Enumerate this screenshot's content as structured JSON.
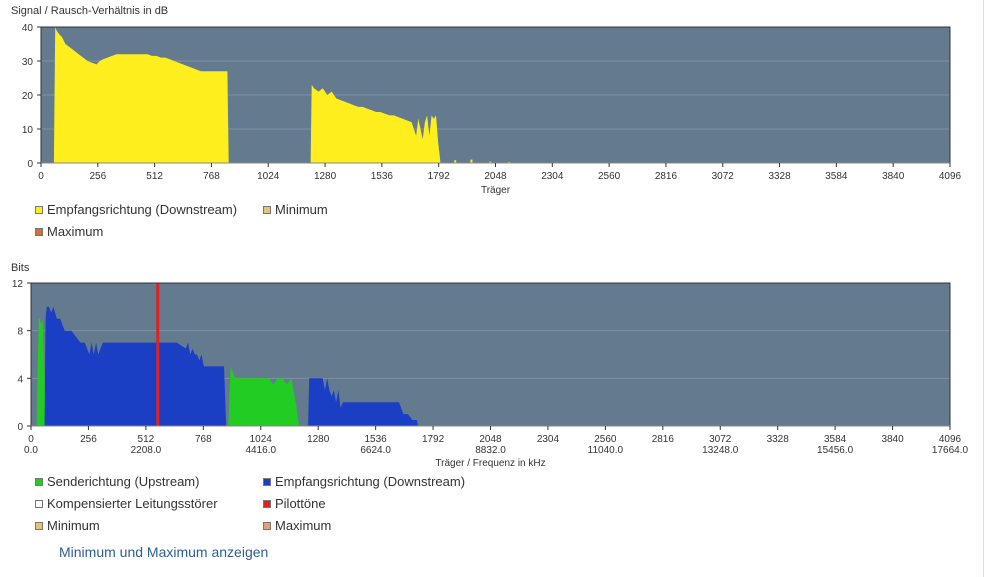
{
  "snr_chart": {
    "ylabel": "Signal / Rausch-Verhältnis in dB",
    "xlabel": "Träger",
    "legend": [
      {
        "label": "Empfangsrichtung (Downstream)",
        "color": "#ffee1e"
      },
      {
        "label": "Minimum",
        "color": "#e8c27a"
      },
      {
        "label": "Maximum",
        "color": "#c8733a"
      }
    ]
  },
  "bits_chart": {
    "ylabel": "Bits",
    "xlabel": "Träger / Frequenz in kHz",
    "legend": [
      {
        "label": "Senderichtung (Upstream)",
        "color": "#22cc22"
      },
      {
        "label": "Empfangsrichtung (Downstream)",
        "color": "#1a3fc4"
      },
      {
        "label": "Kompensierter Leitungsstörer",
        "color": "#ffffff"
      },
      {
        "label": "Pilottöne",
        "color": "#dd2222"
      },
      {
        "label": "Minimum",
        "color": "#e8c27a"
      },
      {
        "label": "Maximum",
        "color": "#e8a06a"
      }
    ]
  },
  "toggle_link": "Minimum und Maximum anzeigen",
  "colors": {
    "plot_bg": "#647a8e",
    "grid": "#7e92a4"
  },
  "chart_data": [
    {
      "type": "area",
      "title": "",
      "xlabel": "Träger",
      "ylabel": "Signal / Rausch-Verhältnis in dB",
      "xlim": [
        0,
        4096
      ],
      "ylim": [
        0,
        40
      ],
      "x_ticks": [
        0,
        256,
        512,
        768,
        1024,
        1280,
        1536,
        1792,
        2048,
        2304,
        2560,
        2816,
        3072,
        3328,
        3584,
        3840,
        4096
      ],
      "y_ticks": [
        0,
        10,
        20,
        30,
        40
      ],
      "grid": true,
      "legend_position": "bottom",
      "series": [
        {
          "name": "Empfangsrichtung (Downstream)",
          "color": "#ffee1e",
          "x": [
            58,
            64,
            70,
            80,
            95,
            110,
            130,
            150,
            170,
            190,
            210,
            230,
            250,
            265,
            280,
            300,
            320,
            340,
            360,
            380,
            400,
            420,
            440,
            460,
            480,
            500,
            520,
            540,
            560,
            580,
            600,
            620,
            640,
            660,
            680,
            700,
            720,
            740,
            760,
            780,
            800,
            820,
            840,
            846,
            1215,
            1220,
            1230,
            1250,
            1270,
            1290,
            1310,
            1330,
            1350,
            1370,
            1390,
            1410,
            1430,
            1450,
            1470,
            1490,
            1510,
            1530,
            1550,
            1570,
            1590,
            1610,
            1630,
            1650,
            1670,
            1690,
            1700,
            1710,
            1720,
            1730,
            1740,
            1750,
            1760,
            1770,
            1780,
            1790,
            1800
          ],
          "y": [
            0,
            40,
            39,
            38,
            37,
            35,
            34,
            33,
            32,
            31,
            30,
            29.5,
            29,
            30,
            30.5,
            31,
            31.5,
            32,
            32,
            32,
            32,
            32,
            32,
            32,
            32,
            31.5,
            31.5,
            31,
            31,
            30.5,
            30,
            29.5,
            29,
            28.5,
            28,
            27.5,
            27,
            27,
            27,
            27,
            27,
            27,
            27,
            0,
            0,
            23,
            22,
            21,
            22,
            20,
            21,
            19,
            18.5,
            18,
            17.5,
            17,
            16.5,
            16.5,
            16,
            15.5,
            15,
            15,
            14.5,
            14,
            14,
            13.5,
            13,
            12.5,
            12,
            8,
            13,
            10,
            7,
            12,
            14,
            8,
            14,
            13,
            14,
            6,
            0
          ]
        }
      ]
    },
    {
      "type": "area",
      "title": "",
      "xlabel": "Träger / Frequenz in kHz",
      "ylabel": "Bits",
      "xlim": [
        0,
        4096
      ],
      "ylim": [
        0,
        12
      ],
      "x_ticks": [
        0,
        256,
        512,
        768,
        1024,
        1280,
        1536,
        1792,
        2048,
        2304,
        2560,
        2816,
        3072,
        3328,
        3584,
        3840,
        4096
      ],
      "x_ticks_khz": [
        "0.0",
        "2208.0",
        "4416.0",
        "6624.0",
        "8832.0",
        "11040.0",
        "13248.0",
        "15456.0",
        "17664.0"
      ],
      "y_ticks": [
        0,
        4,
        8,
        12
      ],
      "grid": true,
      "legend_position": "bottom",
      "series": [
        {
          "name": "Senderichtung (Upstream)",
          "color": "#22cc22",
          "segments": [
            {
              "x": [
                25,
                30,
                35,
                40,
                45,
                50,
                55,
                60,
                64
              ],
              "y": [
                0,
                5,
                9,
                9,
                8.5,
                9,
                8,
                4,
                0
              ]
            },
            {
              "x": [
                880,
                885,
                890,
                900,
                910,
                920,
                940,
                960,
                980,
                1000,
                1020,
                1040,
                1060,
                1080,
                1100,
                1120,
                1140,
                1160,
                1180,
                1195
              ],
              "y": [
                0,
                3,
                5,
                4.5,
                4,
                4,
                4,
                4,
                4,
                4,
                4,
                4,
                4,
                3.5,
                4,
                4,
                3.5,
                4,
                2,
                0
              ]
            }
          ]
        },
        {
          "name": "Empfangsrichtung (Downstream)",
          "color": "#1a3fc4",
          "segments": [
            {
              "x": [
                60,
                65,
                70,
                80,
                90,
                100,
                115,
                130,
                150,
                180,
                200,
                220,
                240,
                260,
                270,
                280,
                290,
                300,
                320,
                340,
                360,
                400,
                450,
                500,
                550,
                600,
                650,
                690,
                700,
                710,
                720,
                730,
                740,
                750,
                760,
                770,
                780,
                800,
                860,
                870
              ],
              "y": [
                0,
                9,
                10,
                10,
                9.5,
                10,
                9,
                9,
                8,
                8,
                7.5,
                7,
                7,
                6,
                7,
                6,
                7,
                6,
                7,
                7,
                7,
                7,
                7,
                7,
                7,
                7,
                7,
                6.5,
                7,
                6,
                6.5,
                6,
                6,
                5.5,
                6,
                5,
                5,
                5,
                5,
                0
              ]
            },
            {
              "x": [
                1235,
                1240,
                1260,
                1280,
                1300,
                1310,
                1320,
                1330,
                1340,
                1350,
                1360,
                1370,
                1380,
                1390,
                1400,
                1420,
                1440,
                1460,
                1480,
                1500,
                1520,
                1540,
                1560,
                1580,
                1600,
                1640,
                1660,
                1680,
                1700,
                1720,
                1725
              ],
              "y": [
                0,
                4,
                4,
                4,
                4,
                3,
                4,
                3,
                2.5,
                3,
                2,
                3,
                1.5,
                2,
                2,
                2,
                2,
                2,
                2,
                2,
                2,
                2,
                2,
                2,
                2,
                2,
                1,
                1,
                0.5,
                0.5,
                0
              ]
            }
          ]
        },
        {
          "name": "Pilottöne",
          "color": "#dd2222",
          "x": [
            565
          ]
        }
      ]
    }
  ]
}
